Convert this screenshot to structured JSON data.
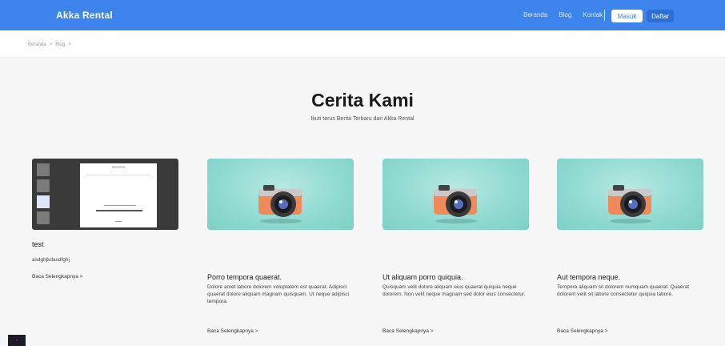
{
  "navbar": {
    "brand": "Akka Rental",
    "links": [
      "Beranda",
      "Blog",
      "Kontak"
    ],
    "login_label": "Masuk",
    "register_label": "Daftar",
    "color": "#3d84ec"
  },
  "breadcrumb": {
    "items": [
      "Beranda",
      ">",
      "Blog",
      ">"
    ]
  },
  "hero": {
    "title": "Cerita Kami",
    "subtitle": "Ikuti terus Berita Terbaru dari Akka Rental"
  },
  "cards": [
    {
      "title": "test",
      "body": "asdghjkdasdfghj",
      "link": "Baca Selengkapnya >",
      "image": "document-thumbnail"
    },
    {
      "title": "Porro tempora quaerat.",
      "body": "Dolore amet labore dolorem voluptatem est quaerat. Adipisci quaerat dolore aliquam magnam quisquam. Ut neque adipisci tempora.",
      "link": "Baca Selengkapnya >",
      "image": "camera-icon"
    },
    {
      "title": "Ut aliquam porro quiquia.",
      "body": "Quisquam velit dolore aliquam eius quaerat quiquia neque dolorem. Non velit neque magnam sed dolor eius consectetur.",
      "link": "Baca Selengkapnya >",
      "image": "camera-icon"
    },
    {
      "title": "Aut tempora neque.",
      "body": "Tempora aliquam sit dolorem numquam quaerat. Quaerat dolorem velit sit labore consectetur quiquia labore.",
      "link": "Baca Selengkapnya >",
      "image": "camera-icon"
    }
  ]
}
